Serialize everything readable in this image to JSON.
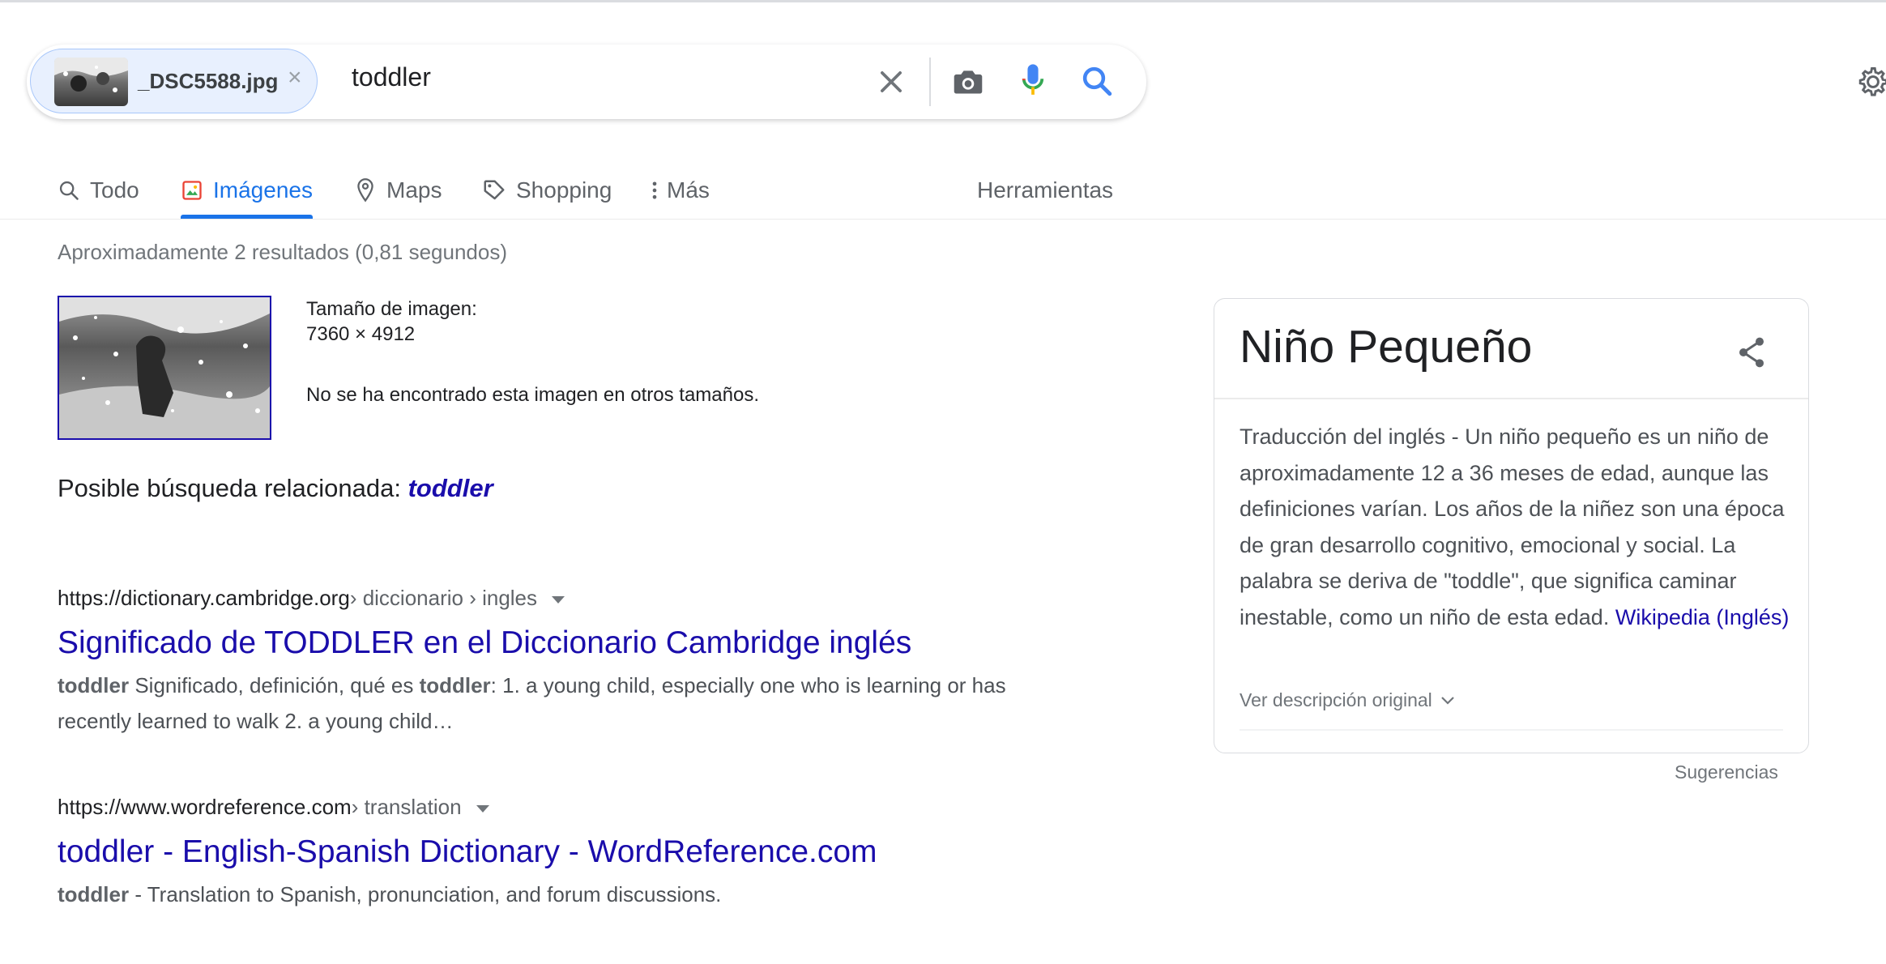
{
  "search": {
    "image_chip_name": "_DSC5588.jpg",
    "image_chip_remove": "×",
    "query": "toddler"
  },
  "tabs": [
    {
      "label": "Todo",
      "icon": "search-icon"
    },
    {
      "label": "Imágenes",
      "icon": "images-icon",
      "active": true
    },
    {
      "label": "Maps",
      "icon": "map-pin-icon"
    },
    {
      "label": "Shopping",
      "icon": "tag-icon"
    },
    {
      "label": "Más",
      "icon": "more-vert-icon"
    },
    {
      "label": "Herramientas"
    }
  ],
  "stats": "Aproximadamente 2 resultados (0,81 segundos)",
  "image_info": {
    "size_label": "Tamaño de imagen:",
    "size_value": "7360 × 4912",
    "no_other_sizes": "No se ha encontrado esta imagen en otros tamaños."
  },
  "related": {
    "prefix": "Posible búsqueda relacionada:",
    "term": "toddler"
  },
  "results": [
    {
      "domain": "https://dictionary.cambridge.org",
      "crumbs": " › diccionario › ingles",
      "title": "Significado de TODDLER en el Diccionario Cambridge inglés",
      "snippet_b1": "toddler",
      "snippet_t1": " Significado, definición, qué es ",
      "snippet_b2": "toddler",
      "snippet_t2": ": 1. a young child, especially one who is learning or has recently learned to walk 2. a young child…"
    },
    {
      "domain": "https://www.wordreference.com",
      "crumbs": " › translation",
      "title": "toddler - English-Spanish Dictionary - WordReference.com",
      "snippet_b1": "toddler",
      "snippet_t1": " - Translation to Spanish, pronunciation, and forum discussions."
    }
  ],
  "knowledge_panel": {
    "title": "Niño Pequeño",
    "description": "Traducción del inglés - Un niño pequeño es un niño de aproximadamente 12 a 36 meses de edad, aunque las definiciones varían. Los años de la niñez son una época de gran desarrollo cognitivo, emocional y social. La palabra se deriva de \"toddle\", que significa caminar inestable, como un niño de esta edad.",
    "source_link": "Wikipedia (Inglés)",
    "original_toggle": "Ver descripción original"
  },
  "suggestions_label": "Sugerencias",
  "colors": {
    "link": "#1a0dab",
    "accent": "#1a73e8",
    "chip_bg": "#e8f0fe"
  }
}
